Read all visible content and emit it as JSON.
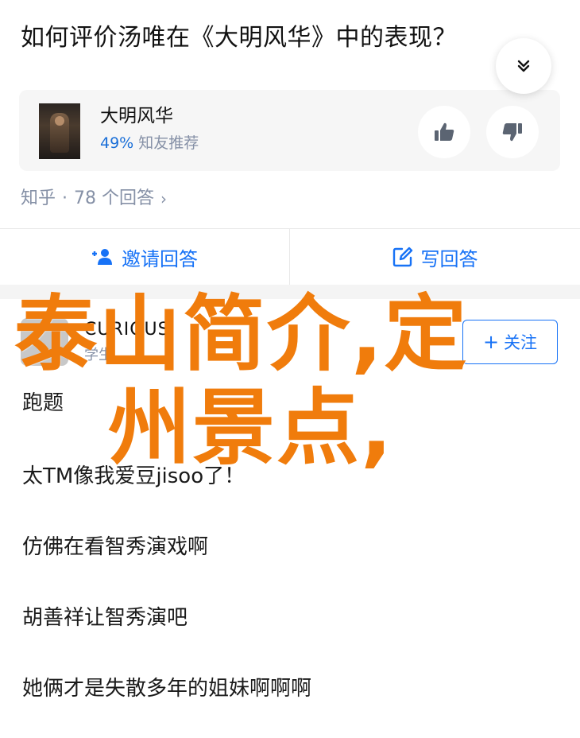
{
  "question": {
    "title": "如何评价汤唯在《大明风华》中的表现？"
  },
  "collapse_icon": "chevron-down-icon",
  "card": {
    "title": "大明风华",
    "rating": "49%",
    "rating_label": "知友推荐"
  },
  "meta": {
    "site": "知乎",
    "separator": "·",
    "answers": "78 个回答",
    "chevron": "›"
  },
  "actions": {
    "invite": "邀请回答",
    "write": "写回答"
  },
  "author": {
    "name": "CURIOUS",
    "desc": "学生",
    "follow": "关注",
    "follow_plus": "+"
  },
  "answer_lines": [
    "跑题",
    "太TM像我爱豆jisoo了！",
    "仿佛在看智秀演戏啊",
    "胡善祥让智秀演吧",
    "她俩才是失散多年的姐妹啊啊啊"
  ],
  "overlay": {
    "line1": "泰山简介,定",
    "line2": "州景点,"
  },
  "colors": {
    "accent_blue": "#1772f6",
    "overlay_orange": "#f07c0c",
    "muted_text": "#8590a6"
  }
}
